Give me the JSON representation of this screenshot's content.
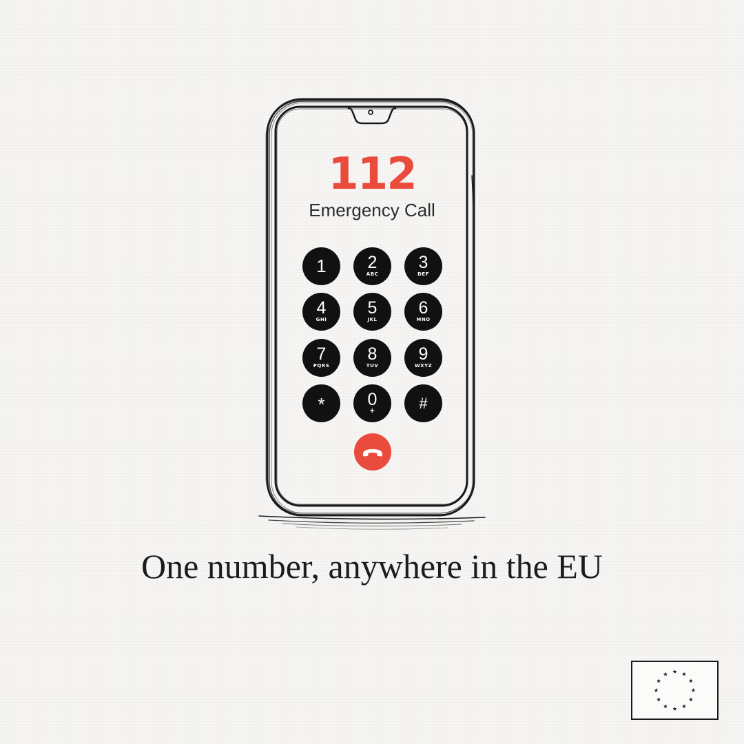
{
  "screen": {
    "number": "112",
    "label": "Emergency Call"
  },
  "keypad": [
    {
      "digit": "1",
      "letters": ""
    },
    {
      "digit": "2",
      "letters": "ABC"
    },
    {
      "digit": "3",
      "letters": "DEF"
    },
    {
      "digit": "4",
      "letters": "GHI"
    },
    {
      "digit": "5",
      "letters": "JKL"
    },
    {
      "digit": "6",
      "letters": "MNO"
    },
    {
      "digit": "7",
      "letters": "PQRS"
    },
    {
      "digit": "8",
      "letters": "TUV"
    },
    {
      "digit": "9",
      "letters": "WXYZ"
    },
    {
      "digit": "*",
      "letters": ""
    },
    {
      "digit": "0",
      "letters": "+"
    },
    {
      "digit": "#",
      "letters": ""
    }
  ],
  "end_call_icon": "phone-hangup-icon",
  "tagline": "One number, anywhere in the EU",
  "flag_icon": "eu-stars-icon",
  "colors": {
    "accent_red": "#e94b3c",
    "key_fill": "#111111",
    "text_dark": "#2b2b2b",
    "outline": "#1a1a1a"
  }
}
